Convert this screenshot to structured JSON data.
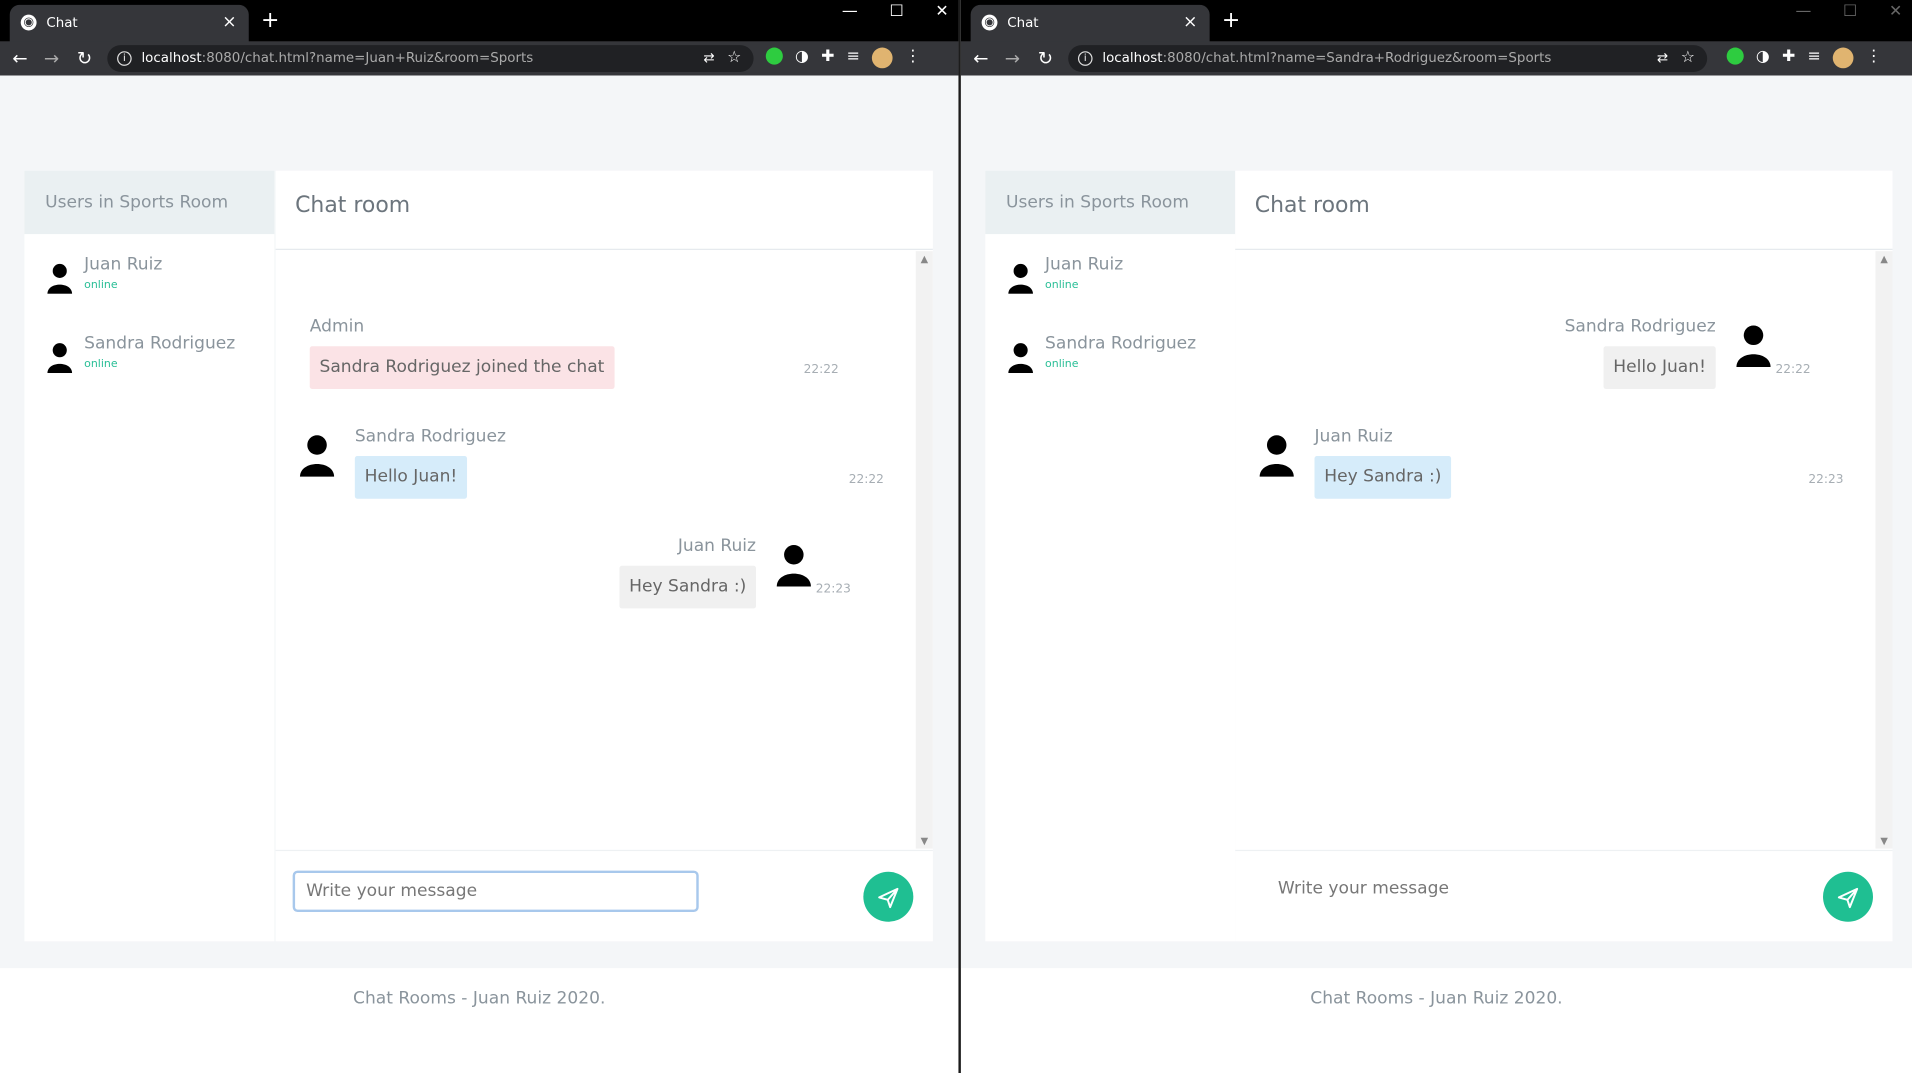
{
  "browser_common": {
    "tab_title": "Chat",
    "new_tab": "+",
    "close_tab": "×",
    "win_min": "—",
    "win_max": "☐",
    "win_close": "✕",
    "host": "localhost",
    "star": "☆"
  },
  "left": {
    "url_path": ":8080/chat.html?name=Juan+Ruiz&room=Sports",
    "sidebar_title": "Users in Sports Room",
    "users": [
      {
        "name": "Juan Ruiz",
        "status": "online"
      },
      {
        "name": "Sandra Rodriguez",
        "status": "online"
      }
    ],
    "chat_title": "Chat room",
    "messages": [
      {
        "author": "Admin",
        "text": "Sandra Rodriguez joined the chat",
        "time": "22:22"
      },
      {
        "author": "Sandra Rodriguez",
        "text": "Hello Juan!",
        "time": "22:22"
      },
      {
        "author": "Juan Ruiz",
        "text": "Hey Sandra :)",
        "time": "22:23"
      }
    ],
    "input_placeholder": "Write your message",
    "footer": "Chat Rooms - Juan Ruiz 2020."
  },
  "right": {
    "url_path": ":8080/chat.html?name=Sandra+Rodriguez&room=Sports",
    "sidebar_title": "Users in Sports Room",
    "users": [
      {
        "name": "Juan Ruiz",
        "status": "online"
      },
      {
        "name": "Sandra Rodriguez",
        "status": "online"
      }
    ],
    "chat_title": "Chat room",
    "messages": [
      {
        "author": "Sandra Rodriguez",
        "text": "Hello Juan!",
        "time": "22:22"
      },
      {
        "author": "Juan Ruiz",
        "text": "Hey Sandra :)",
        "time": "22:23"
      }
    ],
    "input_placeholder": "Write your message",
    "footer": "Chat Rooms - Juan Ruiz 2020."
  },
  "colors": {
    "accent": "#1fbf92",
    "online": "#2bbf97",
    "admin_bubble": "#fbe3e6",
    "in_bubble": "#d6ecfa"
  }
}
